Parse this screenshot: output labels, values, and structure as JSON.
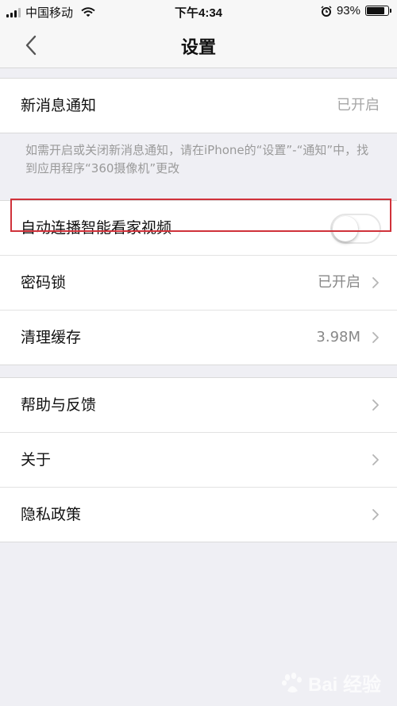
{
  "status_bar": {
    "carrier": "中国移动",
    "time": "下午4:34",
    "battery_percent": "93%",
    "battery_level": 0.93,
    "signal_bars": 3,
    "icons": [
      "signal-icon",
      "wifi-icon",
      "alarm-icon",
      "battery-icon"
    ]
  },
  "nav": {
    "title": "设置",
    "back_icon": "chevron-left-icon"
  },
  "groups": [
    {
      "rows": [
        {
          "label": "新消息通知",
          "value": "已开启"
        }
      ],
      "footnote": "如需开启或关闭新消息通知，请在iPhone的“设置”-“通知”中，找到应用程序“360摄像机”更改"
    },
    {
      "rows": [
        {
          "label": "自动连播智能看家视频",
          "control": "toggle",
          "toggle_on": false
        },
        {
          "label": "密码锁",
          "value": "已开启",
          "chevron": true
        },
        {
          "label": "清理缓存",
          "value": "3.98M",
          "chevron": true
        }
      ]
    },
    {
      "rows": [
        {
          "label": "帮助与反馈",
          "chevron": true
        },
        {
          "label": "关于",
          "chevron": true
        },
        {
          "label": "隐私政策",
          "chevron": true
        }
      ]
    }
  ],
  "watermark": {
    "text": "Bai 经验"
  },
  "colors": {
    "highlight_border": "#d0323a",
    "background": "#efeff4",
    "secondary_text": "#888888"
  }
}
